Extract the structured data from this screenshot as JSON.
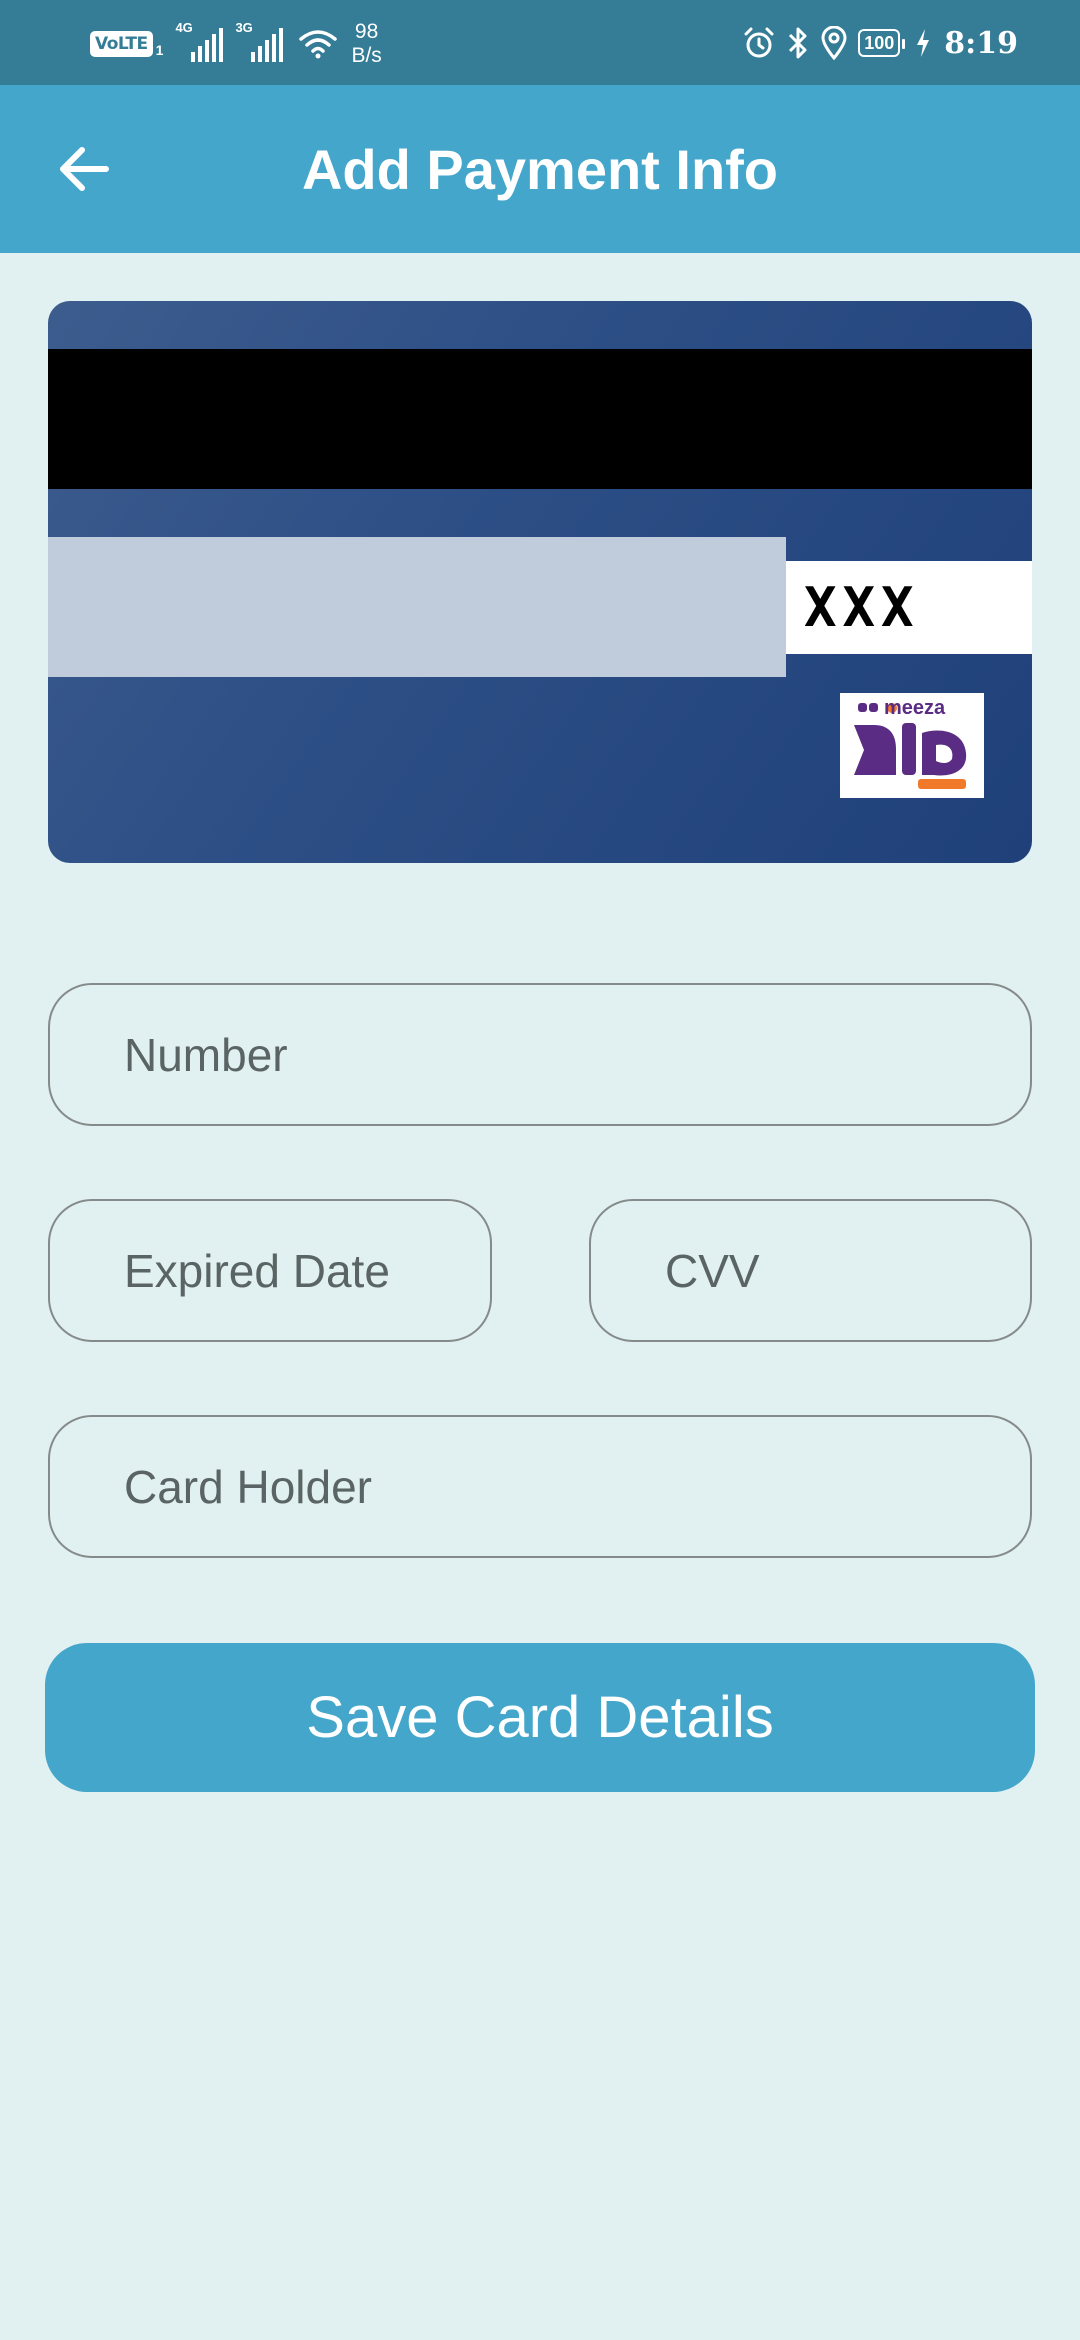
{
  "status_bar": {
    "volte": "VoLTE",
    "volte_sim": "1",
    "net1": "4G",
    "net2": "3G",
    "speed_value": "98",
    "speed_unit": "B/s",
    "battery": "100",
    "time": "8:19"
  },
  "app_bar": {
    "title": "Add Payment Info"
  },
  "card": {
    "cvv_mask": "XXX",
    "logo_text": "meeza",
    "logo_colors": {
      "purple": "#5b2c83",
      "orange": "#f07a2a"
    }
  },
  "form": {
    "number_placeholder": "Number",
    "expiry_placeholder": "Expired Date",
    "cvv_placeholder": "CVV",
    "holder_placeholder": "Card Holder"
  },
  "actions": {
    "save_label": "Save Card Details"
  },
  "colors": {
    "status_bar": "#357d96",
    "app_bar": "#44a6cb",
    "background": "#e1f1f1",
    "card": "#2d4f86",
    "button": "#44a6cb"
  }
}
